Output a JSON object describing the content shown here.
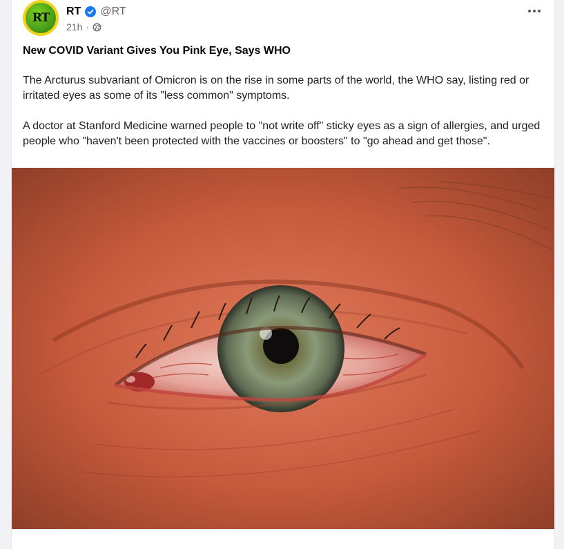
{
  "post": {
    "author": {
      "name": "RT",
      "handle": "@RT",
      "avatar_text": "RT",
      "verified": true
    },
    "meta": {
      "time": "21h",
      "separator": "·",
      "audience_icon": "globe-icon"
    },
    "headline": "New COVID Variant Gives You Pink Eye, Says WHO",
    "paragraphs": [
      "The Arcturus subvariant of Omicron is on the rise in some parts of the world, the WHO say, listing red or irritated eyes as some of its \"less common\" symptoms.",
      "A doctor at Stanford Medicine warned people to \"not write off\" sticky eyes as a sign of allergies, and urged people who \"haven't been protected with the vaccines or boosters\" to \"go ahead and get those\"."
    ],
    "more_icon": "more-options-icon"
  },
  "colors": {
    "verified_blue": "#1877f2",
    "text_primary": "#050505",
    "text_secondary": "#65676b",
    "avatar_ring": "#f2d21b",
    "avatar_green": "#4ca31a"
  }
}
